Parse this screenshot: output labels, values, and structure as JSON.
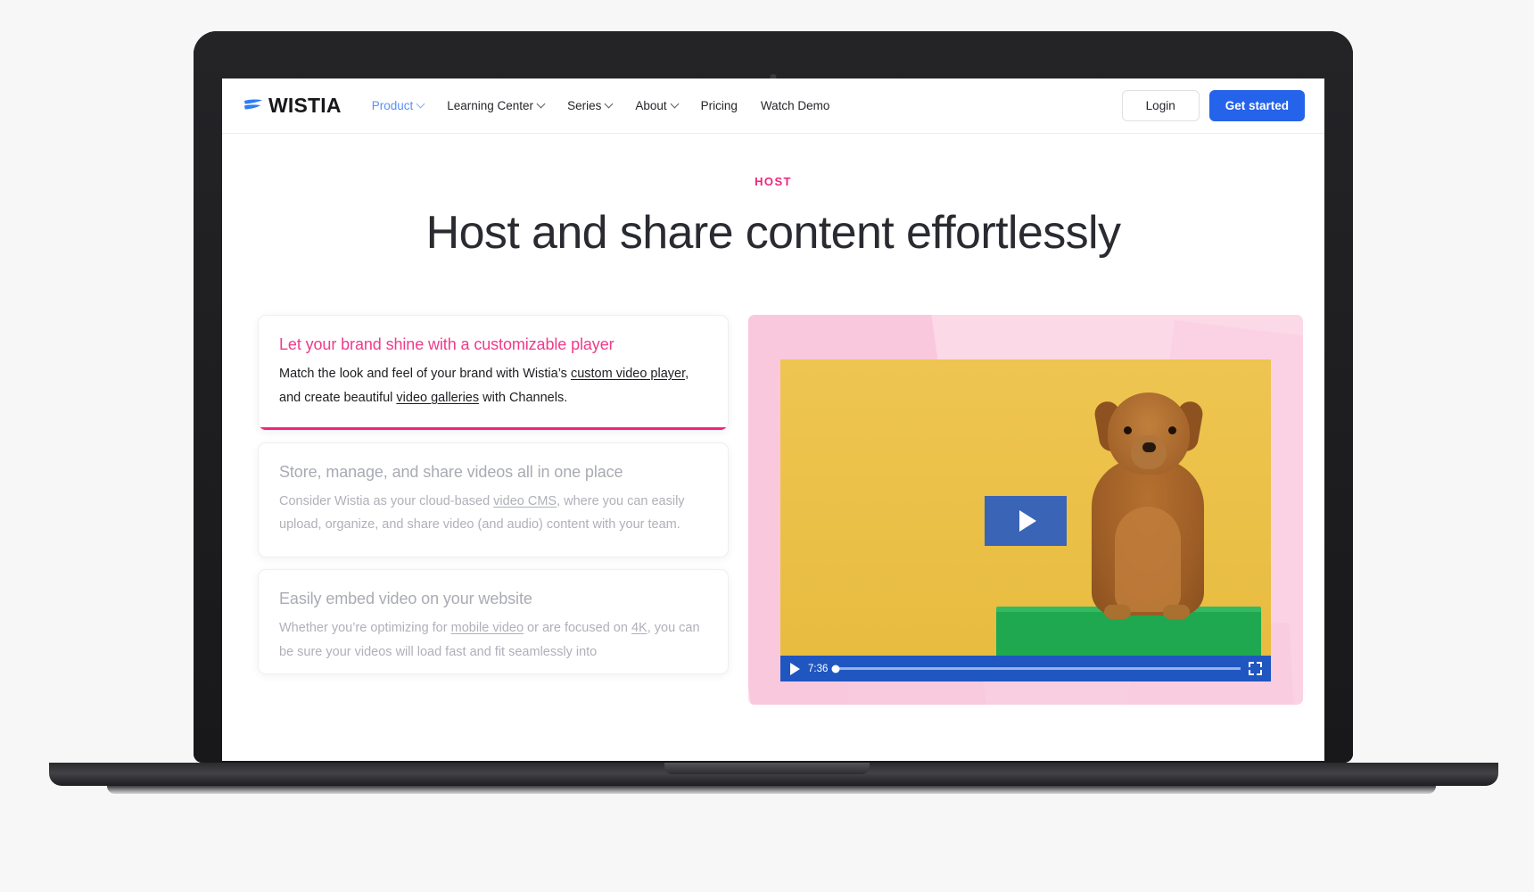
{
  "colors": {
    "brand_pink": "#f0257e",
    "accent_blue": "#2563eb",
    "nav_active": "#5891f5",
    "player_blue": "#1f56c0",
    "video_bg_yellow": "#ecc14a",
    "box_green": "#1fa84f"
  },
  "nav": {
    "logo_text": "WISTIA",
    "links": [
      {
        "label": "Product",
        "has_caret": true,
        "active": true
      },
      {
        "label": "Learning Center",
        "has_caret": true,
        "active": false
      },
      {
        "label": "Series",
        "has_caret": true,
        "active": false
      },
      {
        "label": "About",
        "has_caret": true,
        "active": false
      },
      {
        "label": "Pricing",
        "has_caret": false,
        "active": false
      },
      {
        "label": "Watch Demo",
        "has_caret": false,
        "active": false
      }
    ],
    "login_label": "Login",
    "get_started_label": "Get started"
  },
  "hero": {
    "eyebrow": "HOST",
    "title": "Host and share content effortlessly"
  },
  "cards": [
    {
      "title": "Let your brand shine with a customizable player",
      "body_1": "Match the look and feel of your brand with Wistia’s ",
      "link_1": "custom video player",
      "body_2": ", and create beautiful ",
      "link_2": "video galleries",
      "body_3": " with Channels.",
      "state": "active"
    },
    {
      "title": "Store, manage, and share videos all in one place",
      "body_1": "Consider Wistia as your cloud-based ",
      "link_1": "video CMS",
      "body_2": ", where you can easily upload, organize, and share video (and audio) content with your team.",
      "link_2": "",
      "body_3": "",
      "state": "idle"
    },
    {
      "title": "Easily embed video on your website",
      "body_1": "Whether you’re optimizing for ",
      "link_1": "mobile video",
      "body_2": " or are focused on ",
      "link_2": "4K",
      "body_3": ", you can be sure your videos will load fast and fit seamlessly into",
      "state": "idle"
    }
  ],
  "video": {
    "time": "7:36",
    "play_label": "Play video"
  }
}
